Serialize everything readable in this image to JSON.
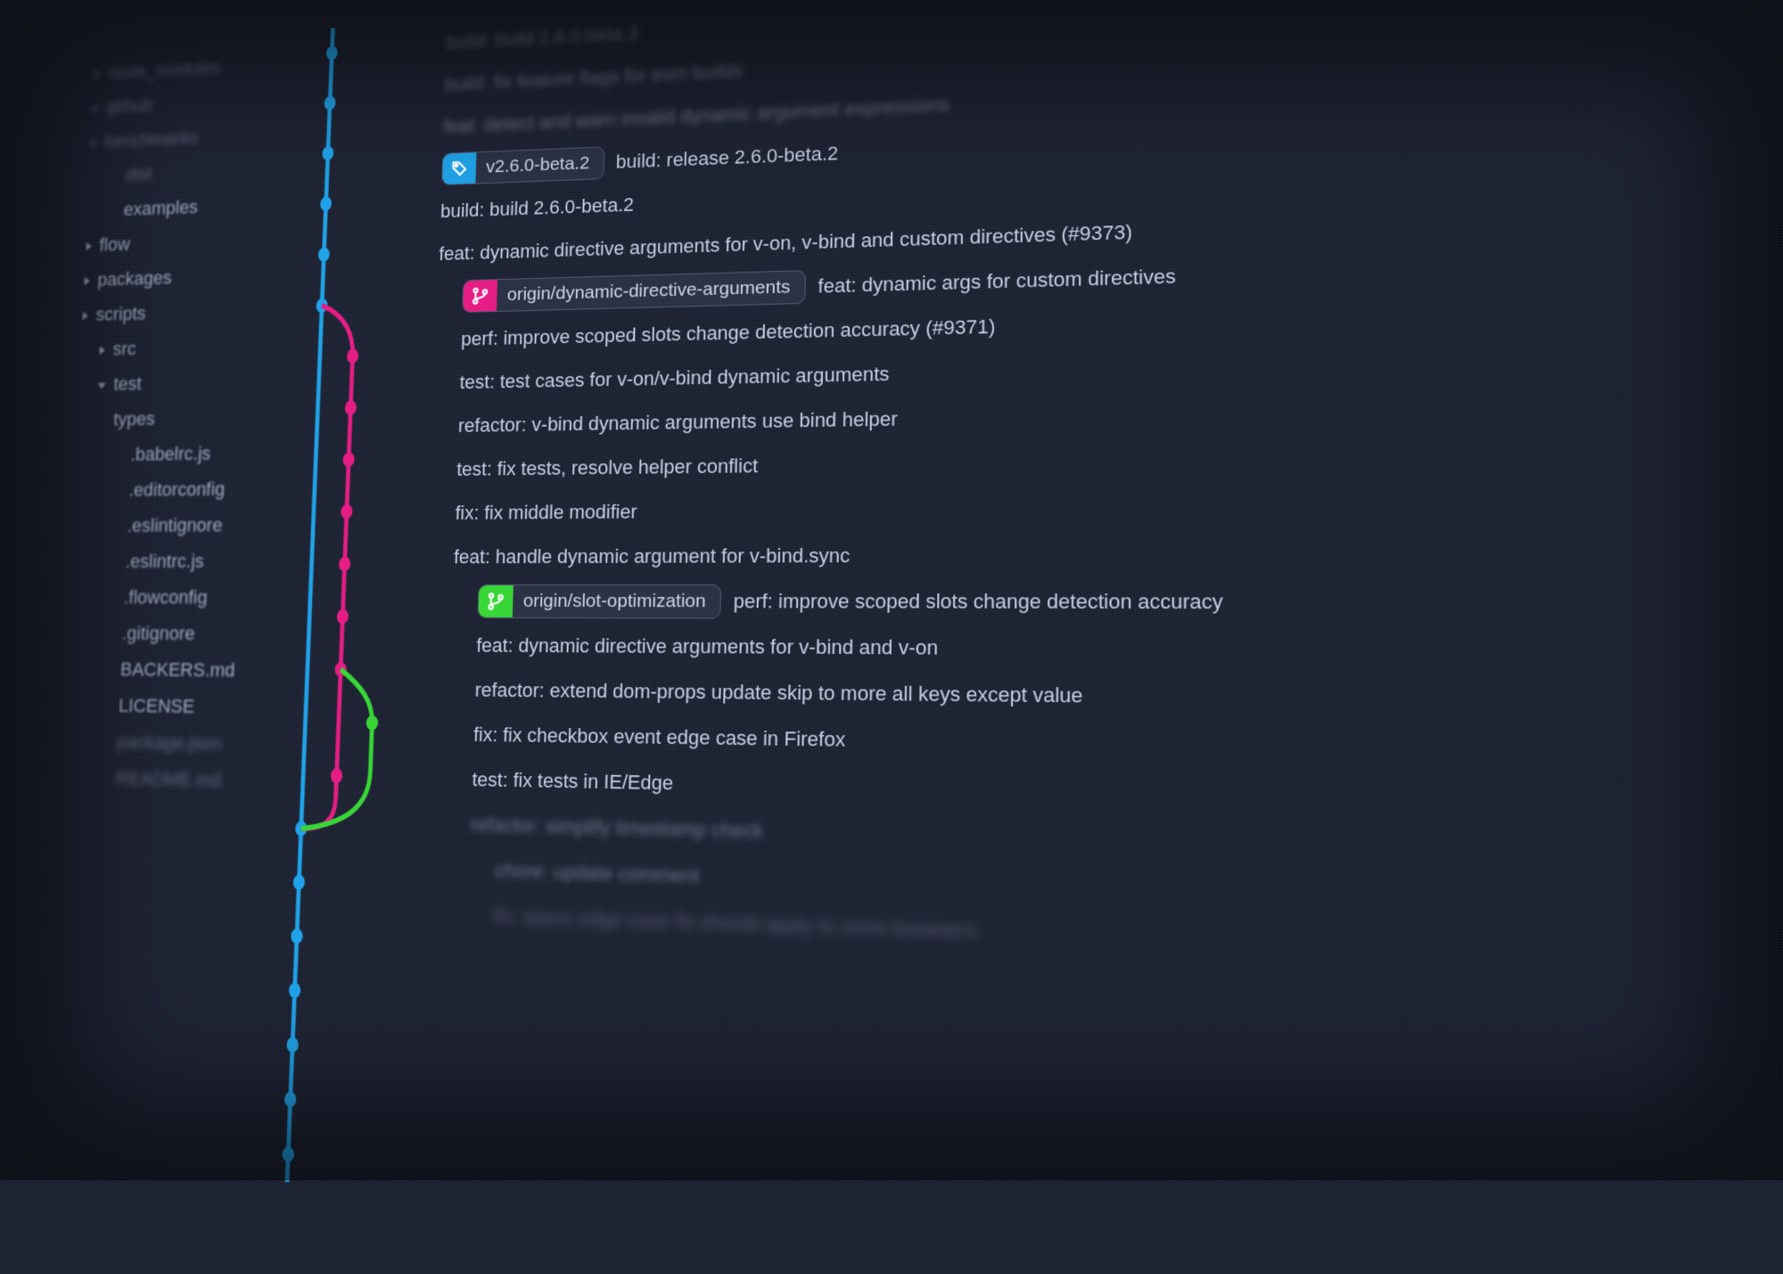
{
  "colors": {
    "blue": "#1fa2e8",
    "pink": "#e51c84",
    "green": "#37d636",
    "bg": "#1e2334",
    "text": "#c7cde2"
  },
  "sidebar": {
    "items": [
      {
        "label": "node_modules",
        "depth": 1,
        "caret": "closed",
        "blur": "top"
      },
      {
        "label": "github",
        "depth": 1,
        "caret": "closed",
        "blur": "top"
      },
      {
        "label": "benchmarks",
        "depth": 1,
        "caret": "closed",
        "blur": "top"
      },
      {
        "label": "dist",
        "depth": 2,
        "caret": "none",
        "blur": "top"
      },
      {
        "label": "examples",
        "depth": 2,
        "caret": "none"
      },
      {
        "label": "flow",
        "depth": 1,
        "caret": "closed"
      },
      {
        "label": "packages",
        "depth": 1,
        "caret": "closed"
      },
      {
        "label": "scripts",
        "depth": 1,
        "caret": "closed"
      },
      {
        "label": "src",
        "depth": 2,
        "caret": "closed"
      },
      {
        "label": "test",
        "depth": 2,
        "caret": "open"
      },
      {
        "label": "types",
        "depth": 2,
        "caret": "none"
      },
      {
        "label": ".babelrc.js",
        "depth": 3,
        "caret": "none"
      },
      {
        "label": ".editorconfig",
        "depth": 3,
        "caret": "none"
      },
      {
        "label": ".eslintignore",
        "depth": 3,
        "caret": "none"
      },
      {
        "label": ".eslintrc.js",
        "depth": 3,
        "caret": "none"
      },
      {
        "label": ".flowconfig",
        "depth": 3,
        "caret": "none"
      },
      {
        "label": ".gitignore",
        "depth": 3,
        "caret": "none"
      },
      {
        "label": "BACKERS.md",
        "depth": 3,
        "caret": "none"
      },
      {
        "label": "LICENSE",
        "depth": 3,
        "caret": "none"
      },
      {
        "label": "package.json",
        "depth": 3,
        "caret": "none",
        "blur": "bot"
      },
      {
        "label": "README.md",
        "depth": 3,
        "caret": "none",
        "blur": "bot"
      }
    ]
  },
  "commits": [
    {
      "message": "build: build 2.6.0-beta.3",
      "indent": 0,
      "blur": "top"
    },
    {
      "message": "build: fix feature flags for esm builds",
      "indent": 0,
      "blur": "top"
    },
    {
      "message": "feat: detect and warn invalid dynamic argument expressions",
      "indent": 0,
      "blur": "top"
    },
    {
      "message": "build: release 2.6.0-beta.2",
      "indent": 0,
      "blur": "",
      "branch": {
        "label": "v2.6.0-beta.2",
        "color": "blue",
        "icon": "tag"
      }
    },
    {
      "message": "build: build 2.6.0-beta.2",
      "indent": 0,
      "blur": ""
    },
    {
      "message": "feat: dynamic directive arguments for v-on, v-bind and custom directives (#9373)",
      "indent": 0,
      "blur": ""
    },
    {
      "message": "feat: dynamic args for custom directives",
      "indent": 1,
      "blur": "",
      "branch": {
        "label": "origin/dynamic-directive-arguments",
        "color": "pink",
        "icon": "branch"
      }
    },
    {
      "message": "perf: improve scoped slots change detection accuracy (#9371)",
      "indent": 1,
      "blur": ""
    },
    {
      "message": "test: test cases for v-on/v-bind dynamic arguments",
      "indent": 1,
      "blur": ""
    },
    {
      "message": "refactor: v-bind dynamic arguments use bind helper",
      "indent": 1,
      "blur": ""
    },
    {
      "message": "test: fix tests, resolve helper conflict",
      "indent": 1,
      "blur": ""
    },
    {
      "message": "fix: fix middle modifier",
      "indent": 1,
      "blur": ""
    },
    {
      "message": "feat: handle dynamic argument for v-bind.sync",
      "indent": 1,
      "blur": ""
    },
    {
      "message": "perf: improve scoped slots change detection accuracy",
      "indent": 2,
      "blur": "",
      "branch": {
        "label": "origin/slot-optimization",
        "color": "green",
        "icon": "branch"
      }
    },
    {
      "message": "feat: dynamic directive arguments for v-bind and v-on",
      "indent": 2,
      "blur": ""
    },
    {
      "message": "refactor: extend dom-props update skip to more all keys except value",
      "indent": 2,
      "blur": ""
    },
    {
      "message": "fix: fix checkbox event edge case in Firefox",
      "indent": 2,
      "blur": ""
    },
    {
      "message": "test: fix tests in IE/Edge",
      "indent": 2,
      "blur": ""
    },
    {
      "message": "refactor: simplify timestamp check",
      "indent": 2,
      "blur": "bot"
    },
    {
      "message": "chore: update comment",
      "indent": 3,
      "blur": "bot"
    },
    {
      "message": "fix: async edge case fix should apply to more browsers",
      "indent": 3,
      "blur": "bot2"
    }
  ]
}
